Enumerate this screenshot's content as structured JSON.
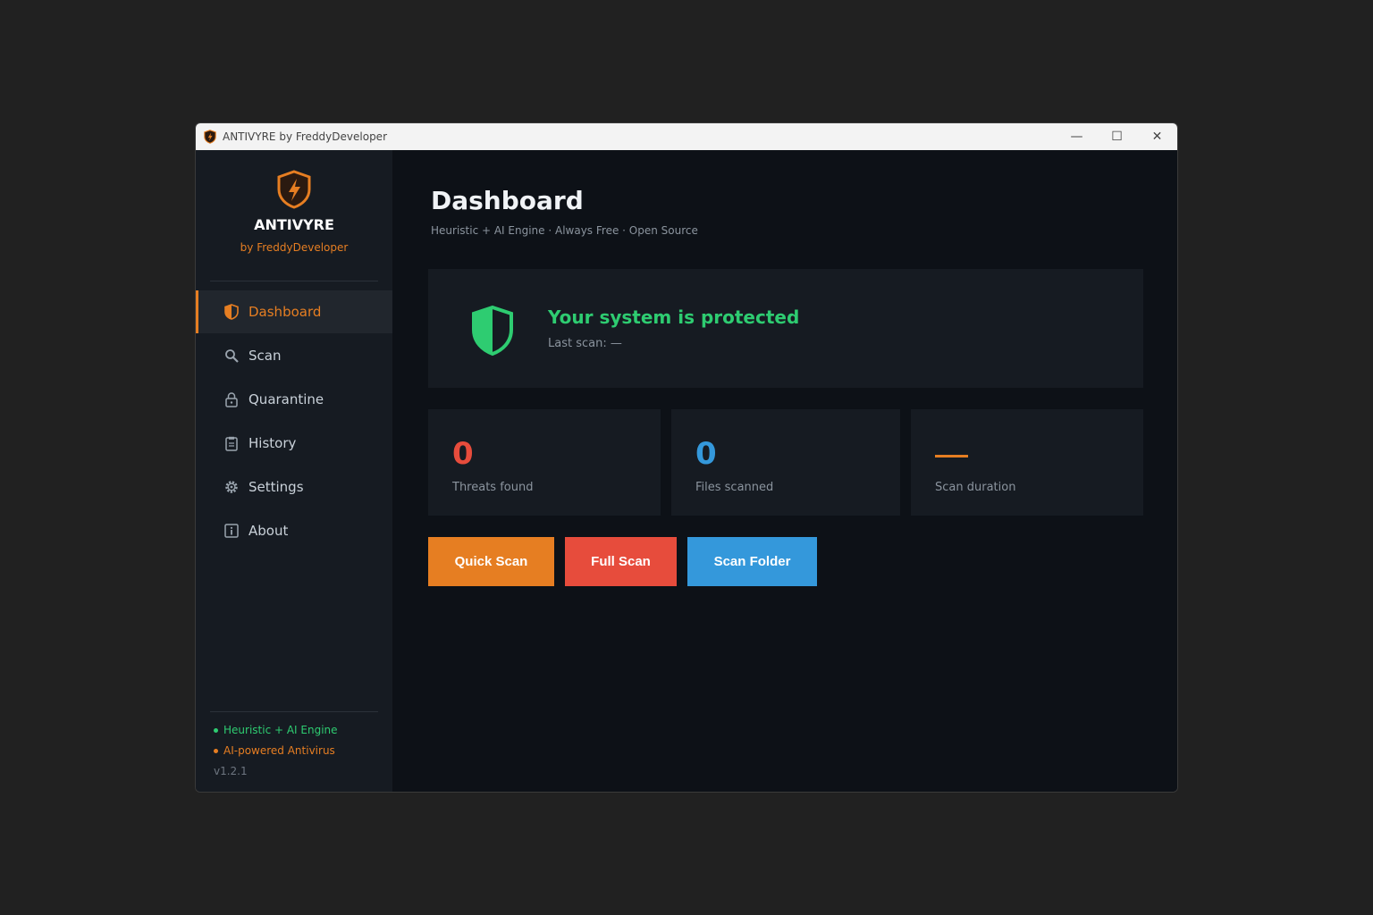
{
  "window": {
    "title": "ANTIVYRE by FreddyDeveloper",
    "controls": {
      "minimize": "—",
      "maximize": "☐",
      "close": "✕"
    }
  },
  "sidebar": {
    "brand": "ANTIVYRE",
    "brand_sub": "by FreddyDeveloper",
    "items": [
      {
        "label": "Dashboard",
        "icon": "shield-icon",
        "active": true
      },
      {
        "label": "Scan",
        "icon": "magnifier-icon"
      },
      {
        "label": "Quarantine",
        "icon": "lock-icon"
      },
      {
        "label": "History",
        "icon": "clipboard-icon"
      },
      {
        "label": "Settings",
        "icon": "gear-icon"
      },
      {
        "label": "About",
        "icon": "info-icon"
      }
    ],
    "footer": {
      "engine": "Heuristic + AI Engine",
      "tagline": "AI-powered Antivirus",
      "version": "v1.2.1"
    }
  },
  "main": {
    "title": "Dashboard",
    "subtitle": "Heuristic + AI Engine · Always Free · Open Source",
    "status": {
      "title": "Your system is protected",
      "last_scan": "Last scan: —"
    },
    "stats": [
      {
        "value": "0",
        "label": "Threats found",
        "color": "#e74c3c"
      },
      {
        "value": "0",
        "label": "Files scanned",
        "color": "#3498db"
      },
      {
        "value": "",
        "label": "Scan duration",
        "color": "#e67e22"
      }
    ],
    "actions": {
      "quick_scan": "Quick Scan",
      "full_scan": "Full Scan",
      "scan_folder": "Scan Folder"
    }
  },
  "colors": {
    "accent": "#e67e22",
    "protected": "#2ecc71",
    "danger": "#e74c3c",
    "info": "#3498db"
  }
}
